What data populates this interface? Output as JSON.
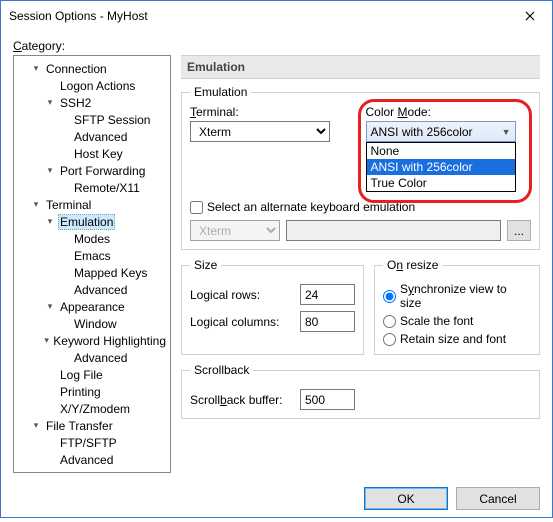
{
  "window": {
    "title": "Session Options - MyHost"
  },
  "category_label": "Category:",
  "tree": {
    "connection": "Connection",
    "logon_actions": "Logon Actions",
    "ssh2": "SSH2",
    "sftp_session": "SFTP Session",
    "advanced": "Advanced",
    "host_key": "Host Key",
    "port_forwarding": "Port Forwarding",
    "remote_x11": "Remote/X11",
    "terminal": "Terminal",
    "emulation": "Emulation",
    "modes": "Modes",
    "emacs": "Emacs",
    "mapped_keys": "Mapped Keys",
    "appearance": "Appearance",
    "window": "Window",
    "keyword_highlighting": "Keyword Highlighting",
    "log_file": "Log File",
    "printing": "Printing",
    "xyzmodem": "X/Y/Zmodem",
    "file_transfer": "File Transfer",
    "ftp_sftp": "FTP/SFTP"
  },
  "panel": {
    "heading": "Emulation",
    "emulation_group": "Emulation",
    "terminal_label_pre": "T",
    "terminal_label_post": "erminal:",
    "terminal_value": "Xterm",
    "alt_kb_label": "Select an alternate keyboard emulation",
    "alt_kb_value": "Xterm",
    "dots": "...",
    "color_mode_label_pre": "Color ",
    "color_mode_label_u": "M",
    "color_mode_label_post": "ode:",
    "color_mode_value": "ANSI with 256color",
    "color_mode_options": {
      "o0": "None",
      "o1": "ANSI with 256color",
      "o2": "True Color"
    },
    "size_group": "Size",
    "logical_rows_pre": "Lo",
    "logical_rows_u": "g",
    "logical_rows_post": "ical rows:",
    "logical_rows_value": "24",
    "logical_cols_label": "Logical columns:",
    "logical_cols_value": "80",
    "onresize_group_pre": "O",
    "onresize_group_u": "n",
    "onresize_group_post": " resize",
    "sync_pre": "S",
    "sync_u": "y",
    "sync_post": "nchronize view to size",
    "scale_label": "Scale the font",
    "retain_label": "Retain size and font",
    "scrollback_group": "Scrollback",
    "scrollback_pre": "Scroll",
    "scrollback_u": "b",
    "scrollback_post": "ack buffer:",
    "scrollback_value": "500"
  },
  "buttons": {
    "ok": "OK",
    "cancel": "Cancel"
  }
}
